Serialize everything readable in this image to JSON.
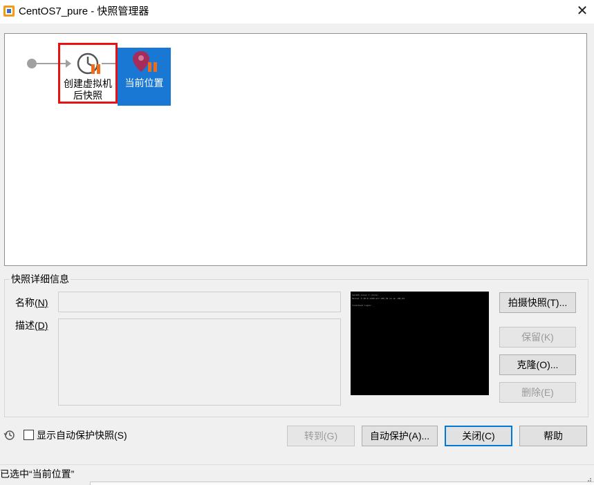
{
  "window": {
    "title": "CentOS7_pure - 快照管理器",
    "app_icon": "vmware-workstation-icon",
    "close_glyph": "✕"
  },
  "tree": {
    "snapshot": {
      "label_line1": "创建虚拟机",
      "label_line2": "后快照",
      "icon": "snapshot-clock-icon",
      "highlighted_border_color": "#e81010"
    },
    "current": {
      "label": "当前位置",
      "icon": "current-location-pin-icon",
      "selected_color": "#1978d4"
    }
  },
  "details": {
    "group_title": "快照详细信息",
    "name_label": "名称",
    "name_mnemonic": "(N)",
    "name_value": "",
    "desc_label": "描述",
    "desc_mnemonic": "(D)",
    "desc_value": "",
    "thumbnail_text": "CentOS Linux 7 (Core)\nKernel 3.10.0-1160.el7.x86_64 on an x86_64\n\nlocalhost login: _"
  },
  "buttons": {
    "take_snapshot": "拍摄快照(T)...",
    "keep": "保留(K)",
    "clone": "克隆(O)...",
    "delete": "删除(E)",
    "goto": "转到(G)",
    "autoprotect": "自动保护(A)...",
    "close": "关闭(C)",
    "help": "帮助"
  },
  "options": {
    "show_autoprotect_label": "显示自动保护快照(S)",
    "show_autoprotect_checked": false
  },
  "status": {
    "text": "已选中“当前位置”"
  }
}
